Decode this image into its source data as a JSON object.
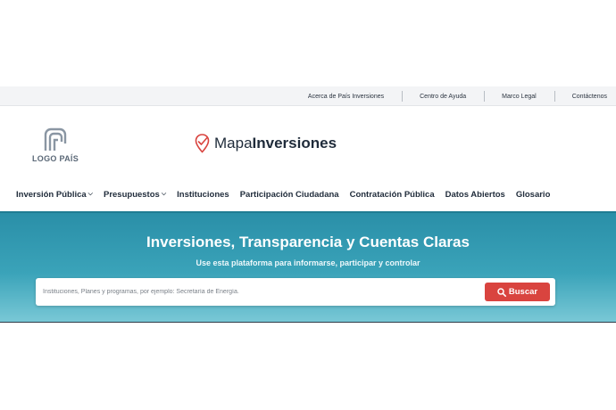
{
  "topbar": {
    "links": [
      "Acerca de País Inversiones",
      "Centro de Ayuda",
      "Marco Legal",
      "Contáctenos"
    ]
  },
  "brand": {
    "country_logo_label": "LOGO PAÍS",
    "site_name_light": "Mapa",
    "site_name_bold": "Inversiones"
  },
  "nav": {
    "items": [
      {
        "label": "Inversión Pública",
        "dropdown": true
      },
      {
        "label": "Presupuestos",
        "dropdown": true
      },
      {
        "label": "Instituciones",
        "dropdown": false
      },
      {
        "label": "Participación Ciudadana",
        "dropdown": false
      },
      {
        "label": "Contratación Pública",
        "dropdown": false
      },
      {
        "label": "Datos Abiertos",
        "dropdown": false
      },
      {
        "label": "Glosario",
        "dropdown": false
      }
    ]
  },
  "hero": {
    "title": "Inversiones, Transparencia y Cuentas Claras",
    "subtitle": "Use esta plataforma para informarse, participar y controlar"
  },
  "search": {
    "placeholder": "Instituciones, Planes y programas, por ejemplo: Secretaría de Energía.",
    "value": "",
    "button_label": "Buscar"
  },
  "colors": {
    "hero_top": "#2a8fa8",
    "hero_bottom": "#79c8d6",
    "accent_red": "#d9443f"
  },
  "icons": {
    "country_logo": "country-logo-icon",
    "site_logo": "map-pin-check-icon",
    "search": "search-icon",
    "caret": "chevron-down-icon"
  }
}
